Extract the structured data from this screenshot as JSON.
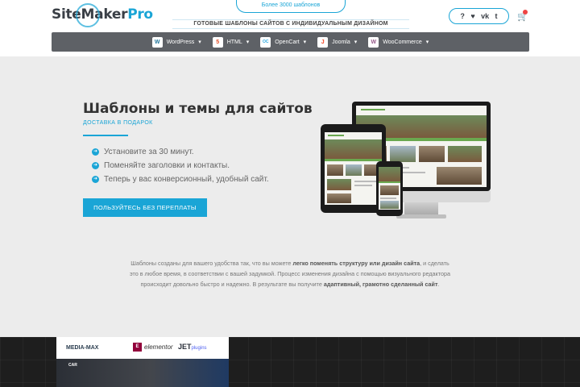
{
  "header": {
    "logo_main": "SiteMaker",
    "logo_pro": "Pro",
    "top_pill": "Более 3000 шаблонов",
    "tagline": "ГОТОВЫЕ ШАБЛОНЫ САЙТОВ С ИНДИВИДУАЛЬНЫМ ДИЗАЙНОМ",
    "social_icons": [
      "question-icon",
      "heart-icon",
      "vk-icon",
      "twitter-icon"
    ],
    "social_glyphs": [
      "?",
      "♥",
      "vk",
      "t"
    ],
    "cart_icon": "🛒"
  },
  "nav": {
    "items": [
      {
        "label": "WordPress",
        "icon": "W",
        "icon_color": "#21759b"
      },
      {
        "label": "HTML",
        "icon": "5",
        "icon_color": "#e44d26"
      },
      {
        "label": "OpenCart",
        "icon": "OC",
        "icon_color": "#2aa8e0"
      },
      {
        "label": "Joomla",
        "icon": "J",
        "icon_color": "#f44321"
      },
      {
        "label": "WooCommerce",
        "icon": "W",
        "icon_color": "#96588a"
      }
    ]
  },
  "hero": {
    "title": "Шаблоны и темы для сайтов",
    "subtitle": "ДОСТАВКА В ПОДАРОК",
    "bullets": [
      "Установите за 30 минут.",
      "Поменяйте заголовки и контакты.",
      "Теперь у вас конверсионный, удобный сайт."
    ],
    "cta": "ПОЛЬЗУЙТЕСЬ БЕЗ ПЕРЕПЛАТЫ"
  },
  "description": {
    "p1": "Шаблоны созданы для вашего удобства так, что вы можете ",
    "b1": "легко поменять структуру или дизайн сайта",
    "p2": ", и сделать это в любое время, в соответствии с вашей задумкой. Процесс изменения дизайна с помощью визуального редактора происходит довольно быстро и надежно. В результате вы получите ",
    "b2": "адаптивный, грамотно сделанный сайт",
    "p3": "."
  },
  "promo": {
    "brand": "MEDIA-MAX",
    "elementor_label": "elementor",
    "elementor_icon": "E",
    "jet_label": "JET",
    "jet_suffix": "plugins",
    "car_text": "CAR"
  }
}
